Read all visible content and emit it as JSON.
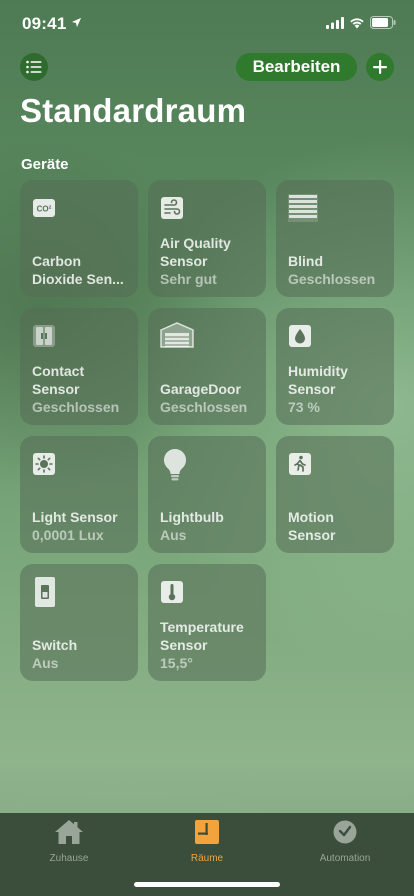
{
  "status_bar": {
    "time": "09:41"
  },
  "header": {
    "edit_label": "Bearbeiten"
  },
  "page": {
    "title": "Standardraum",
    "section": "Geräte"
  },
  "devices": [
    {
      "name": "Carbon\nDioxide Sen...",
      "status": "",
      "icon": "co2-icon"
    },
    {
      "name": "Air Quality\nSensor",
      "status": "Sehr gut",
      "icon": "air-quality-icon"
    },
    {
      "name": "Blind",
      "status": "Geschlossen",
      "icon": "blind-icon"
    },
    {
      "name": "Contact\nSensor",
      "status": "Geschlossen",
      "icon": "contact-sensor-icon"
    },
    {
      "name": "GarageDoor",
      "status": "Geschlossen",
      "icon": "garage-door-icon"
    },
    {
      "name": "Humidity\nSensor",
      "status": "73 %",
      "icon": "humidity-icon"
    },
    {
      "name": "Light Sensor",
      "status": "0,0001 Lux",
      "icon": "light-sensor-icon"
    },
    {
      "name": "Lightbulb",
      "status": "Aus",
      "icon": "lightbulb-icon"
    },
    {
      "name": "Motion\nSensor",
      "status": "",
      "icon": "motion-sensor-icon"
    },
    {
      "name": "Switch",
      "status": "Aus",
      "icon": "switch-icon"
    },
    {
      "name": "Temperature\nSensor",
      "status": "15,5°",
      "icon": "thermometer-icon"
    }
  ],
  "tabs": [
    {
      "label": "Zuhause",
      "icon": "house-icon",
      "active": false
    },
    {
      "label": "Räume",
      "icon": "rooms-icon",
      "active": true
    },
    {
      "label": "Automation",
      "icon": "automation-clock-icon",
      "active": false
    }
  ],
  "colors": {
    "accent": "#f2a33c",
    "button_green": "#2f7a2c"
  }
}
